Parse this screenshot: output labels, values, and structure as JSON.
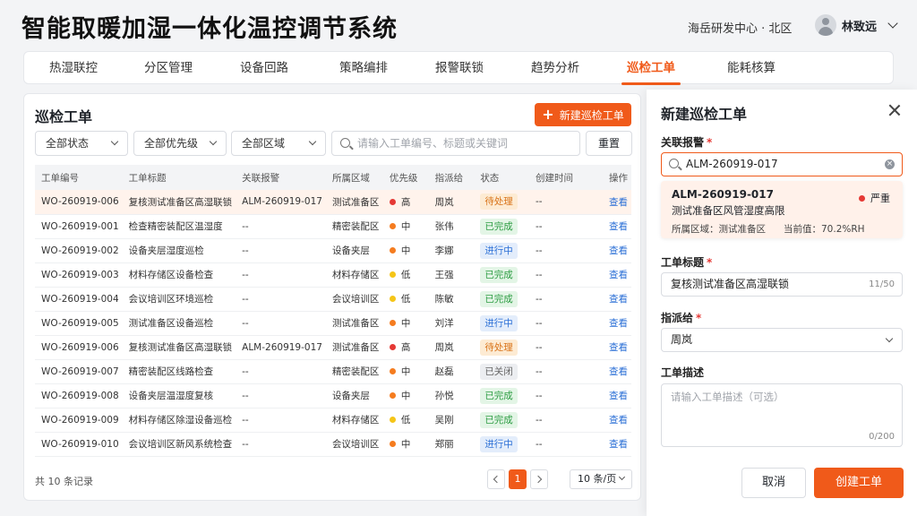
{
  "header": {
    "title": "智能取暖加湿一体化温控调节系统",
    "org": "海岳研发中心 · 北区",
    "user_name": "林致远"
  },
  "nav": {
    "tabs": [
      "热湿联控",
      "分区管理",
      "设备回路",
      "策略编排",
      "报警联锁",
      "趋势分析",
      "巡检工单",
      "能耗核算"
    ],
    "active": "巡检工单"
  },
  "list": {
    "title": "巡检工单",
    "new_button": "新建巡检工单",
    "filters": {
      "status": "全部状态",
      "priority": "全部优先级",
      "zone": "全部区域"
    },
    "search_placeholder": "请输入工单编号、标题或关键词",
    "reset_button": "重置",
    "columns": [
      "工单编号",
      "工单标题",
      "关联报警",
      "所属区域",
      "优先级",
      "指派给",
      "状态",
      "创建时间",
      "操作"
    ],
    "rows": [
      {
        "id": "WO-260919-006",
        "title": "复核测试准备区高湿联锁",
        "alarm": "ALM-260919-017",
        "zone": "测试准备区",
        "priority": "高",
        "assignee": "周岚",
        "status": "待处理",
        "created": "--",
        "action": "查看",
        "selected": true
      },
      {
        "id": "WO-260919-001",
        "title": "检查精密装配区温湿度",
        "alarm": "--",
        "zone": "精密装配区",
        "priority": "中",
        "assignee": "张伟",
        "status": "已完成",
        "created": "--",
        "action": "查看"
      },
      {
        "id": "WO-260919-002",
        "title": "设备夹层湿度巡检",
        "alarm": "--",
        "zone": "设备夹层",
        "priority": "中",
        "assignee": "李娜",
        "status": "进行中",
        "created": "--",
        "action": "查看"
      },
      {
        "id": "WO-260919-003",
        "title": "材料存储区设备检查",
        "alarm": "--",
        "zone": "材料存储区",
        "priority": "低",
        "assignee": "王强",
        "status": "已完成",
        "created": "--",
        "action": "查看"
      },
      {
        "id": "WO-260919-004",
        "title": "会议培训区环境巡检",
        "alarm": "--",
        "zone": "会议培训区",
        "priority": "低",
        "assignee": "陈敏",
        "status": "已完成",
        "created": "--",
        "action": "查看"
      },
      {
        "id": "WO-260919-005",
        "title": "测试准备区设备巡检",
        "alarm": "--",
        "zone": "测试准备区",
        "priority": "中",
        "assignee": "刘洋",
        "status": "进行中",
        "created": "--",
        "action": "查看"
      },
      {
        "id": "WO-260919-006",
        "title": "复核测试准备区高湿联锁",
        "alarm": "ALM-260919-017",
        "zone": "测试准备区",
        "priority": "高",
        "assignee": "周岚",
        "status": "待处理",
        "created": "--",
        "action": "查看"
      },
      {
        "id": "WO-260919-007",
        "title": "精密装配区线路检查",
        "alarm": "--",
        "zone": "精密装配区",
        "priority": "中",
        "assignee": "赵磊",
        "status": "已关闭",
        "created": "--",
        "action": "查看"
      },
      {
        "id": "WO-260919-008",
        "title": "设备夹层温湿度复核",
        "alarm": "--",
        "zone": "设备夹层",
        "priority": "中",
        "assignee": "孙悦",
        "status": "已完成",
        "created": "--",
        "action": "查看"
      },
      {
        "id": "WO-260919-009",
        "title": "材料存储区除湿设备巡检",
        "alarm": "--",
        "zone": "材料存储区",
        "priority": "低",
        "assignee": "吴刚",
        "status": "已完成",
        "created": "--",
        "action": "查看"
      },
      {
        "id": "WO-260919-010",
        "title": "会议培训区新风系统检查",
        "alarm": "--",
        "zone": "会议培训区",
        "priority": "中",
        "assignee": "郑丽",
        "status": "进行中",
        "created": "--",
        "action": "查看"
      }
    ],
    "total_text": "共 10 条记录",
    "current_page": "1",
    "page_size": "10 条/页"
  },
  "colors": {
    "accent": "#f05a1a",
    "priority": {
      "高": "#e53935",
      "中": "#f57c1f",
      "低": "#f5c518"
    },
    "status": {
      "待处理": {
        "bg": "#fdebd3",
        "fg": "#d9741a"
      },
      "已完成": {
        "bg": "#e3f5e6",
        "fg": "#2e9d44"
      },
      "进行中": {
        "bg": "#e3edfb",
        "fg": "#2b6fd6"
      },
      "已关闭": {
        "bg": "#eceef1",
        "fg": "#666666"
      }
    }
  },
  "drawer": {
    "title": "新建巡检工单",
    "alarm_label": "关联报警",
    "alarm_value": "ALM-260919-017",
    "alarm_card": {
      "id": "ALM-260919-017",
      "severity": "严重",
      "desc": "测试准备区风管湿度高限",
      "zone_text": "所属区域：测试准备区",
      "value_text": "当前值：70.2%RH"
    },
    "title_label": "工单标题",
    "title_value": "复核测试准备区高湿联锁",
    "title_count": "11/50",
    "assignee_label": "指派给",
    "assignee_value": "周岚",
    "desc_label": "工单描述",
    "desc_placeholder": "请输入工单描述（可选）",
    "desc_count": "0/200",
    "cancel_button": "取消",
    "create_button": "创建工单"
  }
}
